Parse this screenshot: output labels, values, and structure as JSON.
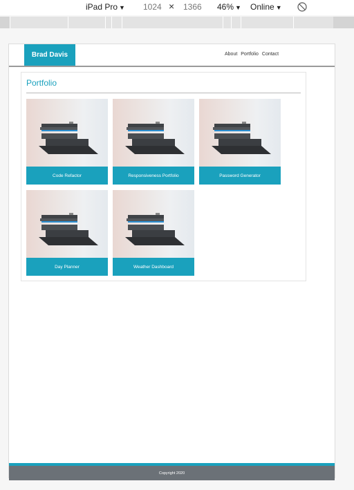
{
  "devtools": {
    "device": "iPad Pro",
    "width": "1024",
    "times": "×",
    "height": "1366",
    "zoom": "46%",
    "network": "Online"
  },
  "site": {
    "brand": "Brad Davis",
    "nav": [
      "About",
      "Portfolio",
      "Contact"
    ]
  },
  "portfolio": {
    "title": "Portfolio",
    "items": [
      {
        "label": "Code Refactor"
      },
      {
        "label": "Responsiveness Portfolio"
      },
      {
        "label": "Password Generator"
      },
      {
        "label": "Day Planner"
      },
      {
        "label": "Weather Dashboard"
      }
    ]
  },
  "footer": {
    "text": "Copyright 2020"
  },
  "colors": {
    "accent": "#1aa1bd",
    "footer": "#6b7177"
  }
}
